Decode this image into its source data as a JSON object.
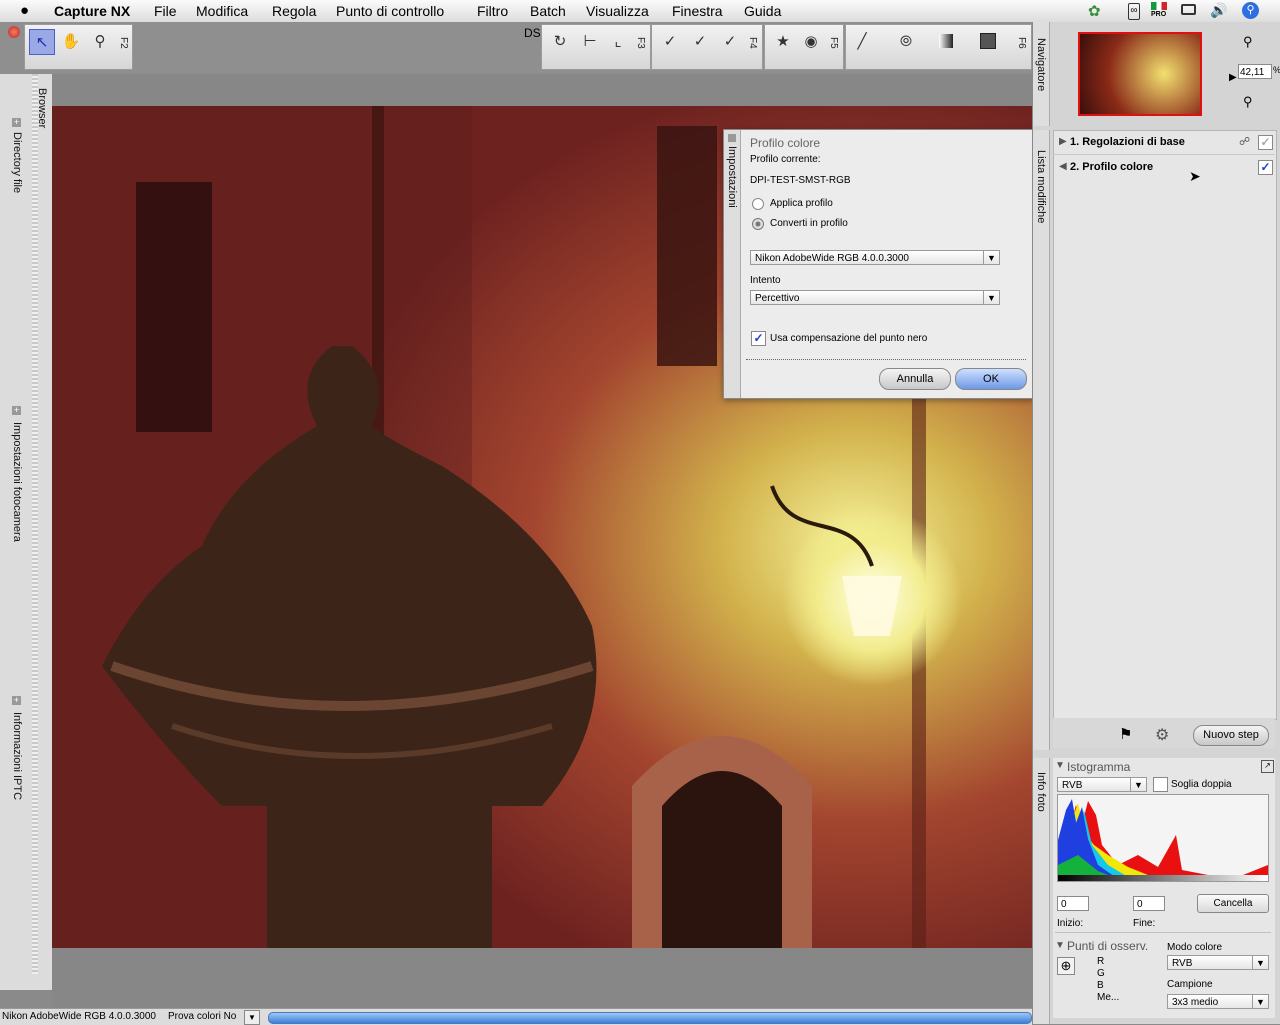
{
  "menubar": {
    "app_name": "Capture NX",
    "items": [
      "File",
      "Modifica",
      "Regola",
      "Punto di controllo",
      "Filtro",
      "Batch",
      "Visualizza",
      "Finestra",
      "Guida"
    ],
    "status_icons": [
      "leaf-icon",
      "bluetooth-icon",
      "flag-icon",
      "display-icon",
      "volume-icon",
      "spotlight-icon"
    ],
    "language_badge": "PRO"
  },
  "toolbar": {
    "fkeys": [
      "F2",
      "F3",
      "F4",
      "F5",
      "F6"
    ],
    "ds_label": "DS"
  },
  "left_sidebar": {
    "browser_label": "Browser",
    "tabs": [
      "Directory file",
      "Impostazioni fotocamera",
      "Informazioni IPTC"
    ]
  },
  "dialog": {
    "panel_label": "Impostazioni",
    "title": "Profilo colore",
    "current_profile_label": "Profilo corrente:",
    "current_profile_value": "DPI-TEST-SMST-RGB",
    "radio_apply": "Applica profilo",
    "radio_convert": "Converti in profilo",
    "selected_radio": "convert",
    "profile_select": "Nikon AdobeWide RGB 4.0.0.3000",
    "intent_label": "Intento",
    "intent_select": "Percettivo",
    "black_point_label": "Usa compensazione del punto nero",
    "black_point_checked": true,
    "cancel_label": "Annulla",
    "ok_label": "OK"
  },
  "navigator": {
    "label": "Navigatore",
    "zoom_value": "42,11",
    "zoom_unit": "%"
  },
  "edit_list": {
    "label": "Lista modifiche",
    "steps": [
      {
        "label": "1. Regolazioni di base",
        "expanded": false,
        "checked": false
      },
      {
        "label": "2. Profilo colore",
        "expanded": true,
        "checked": true
      }
    ],
    "new_step_label": "Nuovo step"
  },
  "photo_info": {
    "label": "Info foto",
    "histogram_title": "Istogramma",
    "channel_select": "RVB",
    "double_threshold_label": "Soglia doppia",
    "start_value": "0",
    "end_value": "0",
    "start_label": "Inizio:",
    "end_label": "Fine:",
    "cancel_label": "Cancella",
    "watch_points_title": "Punti di osserv.",
    "channels": [
      "R",
      "G",
      "B",
      "Me..."
    ],
    "color_mode_label": "Modo colore",
    "color_mode_select": "RVB",
    "sample_label": "Campione",
    "sample_select": "3x3 medio"
  },
  "statusbar": {
    "profile": "Nikon AdobeWide RGB 4.0.0.3000",
    "proof": "Prova colori No"
  }
}
